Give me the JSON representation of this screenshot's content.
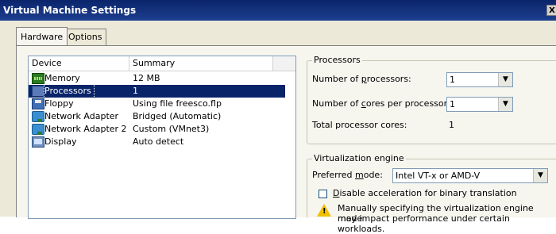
{
  "window": {
    "title": "Virtual Machine Settings",
    "close_glyph": "X"
  },
  "tabs": [
    {
      "label": "Hardware"
    },
    {
      "label": "Options"
    }
  ],
  "device_list": {
    "headers": {
      "device": "Device",
      "summary": "Summary"
    },
    "rows": [
      {
        "name": "Memory",
        "summary": "12 MB",
        "icon": "memory-icon"
      },
      {
        "name": "Processors",
        "summary": "1",
        "icon": "processor-icon",
        "selected": true
      },
      {
        "name": "Floppy",
        "summary": "Using file freesco.flp",
        "icon": "floppy-icon"
      },
      {
        "name": "Network Adapter",
        "summary": "Bridged (Automatic)",
        "icon": "network-adapter-icon"
      },
      {
        "name": "Network Adapter 2",
        "summary": "Custom (VMnet3)",
        "icon": "network-adapter-icon"
      },
      {
        "name": "Display",
        "summary": "Auto detect",
        "icon": "display-icon"
      }
    ]
  },
  "processors": {
    "legend": "Processors",
    "num_processors": {
      "label_pre": "Number of ",
      "label_key": "p",
      "label_post": "rocessors:",
      "value": "1"
    },
    "cores_per_processor": {
      "label_pre": "Number of ",
      "label_key": "c",
      "label_post": "ores per processor:",
      "value": "1"
    },
    "total_cores": {
      "label": "Total processor cores:",
      "value": "1"
    }
  },
  "virtualization": {
    "legend": "Virtualization engine",
    "preferred_mode": {
      "label_pre": "Preferred ",
      "label_key": "m",
      "label_post": "ode:",
      "value": "Intel VT-x or AMD-V"
    },
    "disable_accel": {
      "label_key": "D",
      "label_post": "isable acceleration for binary translation",
      "checked": false
    },
    "warning": {
      "line1": "Manually specifying the virtualization engine mode",
      "line2": "may impact performance under certain workloads."
    }
  }
}
